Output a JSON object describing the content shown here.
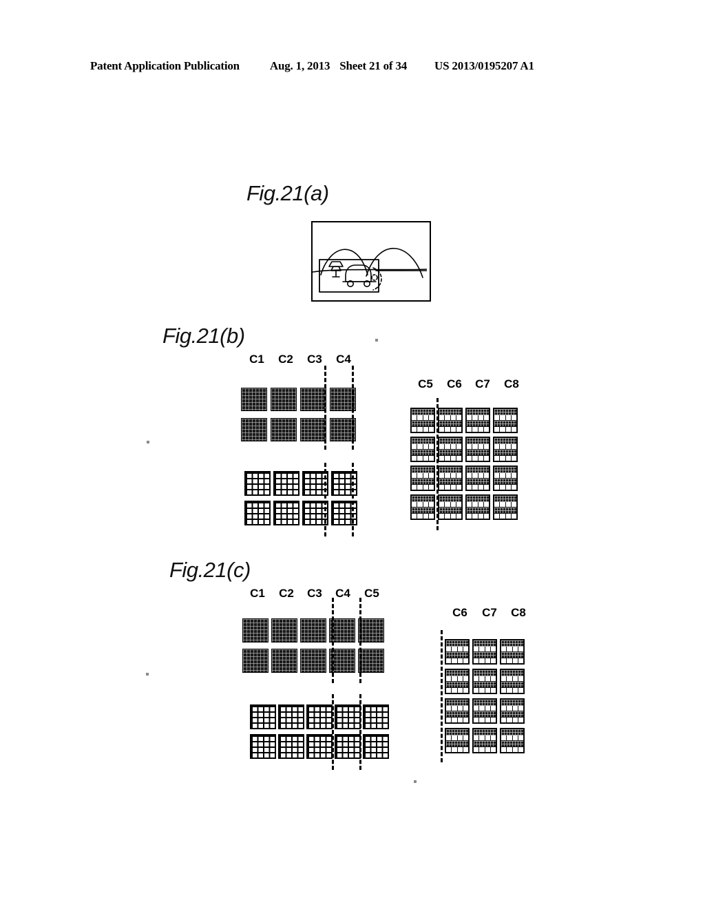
{
  "header": {
    "publication": "Patent Application Publication",
    "date": "Aug. 1, 2013",
    "sheet": "Sheet 21 of 34",
    "patent_number": "US 2013/0195207 A1"
  },
  "figures": {
    "a": {
      "label": "Fig.21(a)",
      "description": "Line drawing of a scene: two hills on the horizon, a road, a tree and a car inside a rectangular region-of-interest box with a dashed arc at its right side",
      "scene_elements": [
        "outer-frame",
        "hill-left",
        "hill-right",
        "horizon-line",
        "roi-box",
        "tree",
        "car",
        "dashed-arc"
      ]
    },
    "b": {
      "label": "Fig.21(b)",
      "left_group": {
        "columns": [
          "C1",
          "C2",
          "C3",
          "C4"
        ],
        "dense_rows": 2,
        "coarse_rows": 2,
        "dash_after_columns": [
          3,
          4
        ]
      },
      "right_group": {
        "columns": [
          "C5",
          "C6",
          "C7",
          "C8"
        ],
        "banded_rows": 4,
        "dash_after_columns": [
          1
        ]
      }
    },
    "c": {
      "label": "Fig.21(c)",
      "left_group": {
        "columns": [
          "C1",
          "C2",
          "C3",
          "C4",
          "C5"
        ],
        "dense_rows": 2,
        "coarse_rows": 2,
        "dash_after_columns": [
          3,
          4
        ]
      },
      "right_group": {
        "columns": [
          "C6",
          "C7",
          "C8"
        ],
        "banded_rows": 4,
        "dash_before_columns": [
          1
        ]
      }
    }
  },
  "colors": {
    "ink": "#000000",
    "paper": "#ffffff",
    "dense_block": "#1a1a1a",
    "band_dark": "#1c1c1c",
    "band_cell": "#ffffff"
  }
}
